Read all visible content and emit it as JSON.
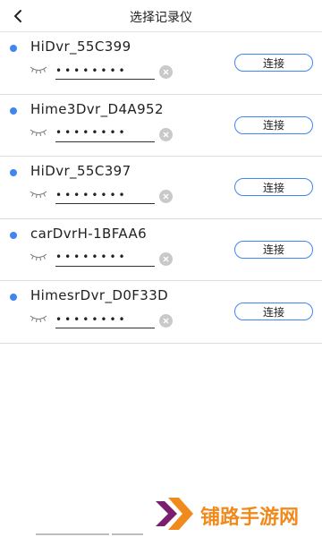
{
  "header": {
    "title": "选择记录仪"
  },
  "devices": [
    {
      "name": "HiDvr_55C399",
      "password": "••••••••",
      "connect_label": "连接"
    },
    {
      "name": "Hime3Dvr_D4A952",
      "password": "••••••••",
      "connect_label": "连接"
    },
    {
      "name": "HiDvr_55C397",
      "password": "••••••••",
      "connect_label": "连接"
    },
    {
      "name": "carDvrH-1BFAA6",
      "password": "••••••••",
      "connect_label": "连接"
    },
    {
      "name": "HimesrDvr_D0F33D",
      "password": "••••••••",
      "connect_label": "连接"
    }
  ],
  "watermark": {
    "text": "铺路手游网"
  },
  "colors": {
    "accent": "#3f86f0",
    "watermark": "#f08a1c",
    "watermark_dark": "#7a1e6e"
  },
  "icons": {
    "back": "chevron-left-icon",
    "status": "dot-icon",
    "password_toggle": "eye-closed-icon",
    "clear": "clear-icon"
  }
}
